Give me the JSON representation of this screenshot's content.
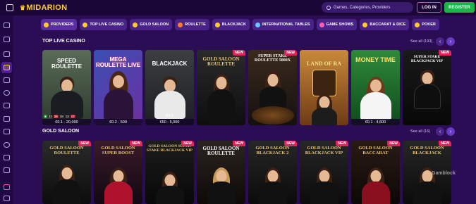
{
  "header": {
    "logo_text": "MIDARION",
    "search_placeholder": "Games, Categories, Providers",
    "login_label": "LOG IN",
    "register_label": "REGISTER"
  },
  "categories": [
    {
      "label": "PROVIDERS"
    },
    {
      "label": "TOP LIVE CASINO"
    },
    {
      "label": "GOLD SALOON"
    },
    {
      "label": "ROULETTE"
    },
    {
      "label": "BLACKJACK"
    },
    {
      "label": "INTERNATIONAL TABLES"
    },
    {
      "label": "GAME SHOWS"
    },
    {
      "label": "BACCARAT & DICE"
    },
    {
      "label": "POKER"
    }
  ],
  "sections": [
    {
      "title": "TOP LIVE CASINO",
      "see_all": "See all (193)",
      "cards": [
        {
          "title": "SPEED ROULETTE",
          "limits": "€0.1 - 20,000",
          "new": ""
        },
        {
          "title": "MEGA ROULETTE LIVE",
          "limits": "€0.2 - 500",
          "new": ""
        },
        {
          "title": "BLACKJACK",
          "limits": "€50 - 5,000",
          "seats": "5 / 7",
          "new": ""
        },
        {
          "title": "GOLD SALOON ROULETTE",
          "limits": "",
          "new": "NEW"
        },
        {
          "title": "SUPER STAKE ROULETTE 5000X",
          "limits": "",
          "new": "NEW"
        },
        {
          "title": "LAND OF RA",
          "limits": "",
          "new": ""
        },
        {
          "title": "MONEY TIME",
          "limits": "€0.1 - 4,600",
          "new": ""
        },
        {
          "title": "SUPER STAKE BLACKJACK VIP",
          "limits": "",
          "new": "NEW"
        }
      ]
    },
    {
      "title": "GOLD SALOON",
      "see_all": "See all (16)",
      "cards": [
        {
          "title": "GOLD SALOON ROULETTE",
          "new": "NEW"
        },
        {
          "title": "GOLD SALOON SUPER BOOST",
          "new": "NEW"
        },
        {
          "title": "GOLD SALOON SUPER STAKE BLACKJACK VIP",
          "new": "NEW"
        },
        {
          "title": "GOLD SALOON ROULETTE",
          "new": "NEW"
        },
        {
          "title": "GOLD SALOON BLACKJACK 2",
          "new": "NEW"
        },
        {
          "title": "GOLD SALOON BLACKJACK VIP",
          "new": "NEW"
        },
        {
          "title": "GOLD SALOON BACCARAT",
          "new": "NEW"
        },
        {
          "title": "GOLD SALOON BLACKJACK",
          "new": "NEW"
        }
      ]
    }
  ],
  "roulette_numbers": [
    "33",
    "26",
    "18",
    "13",
    "17"
  ],
  "watermark": "Gamblock"
}
